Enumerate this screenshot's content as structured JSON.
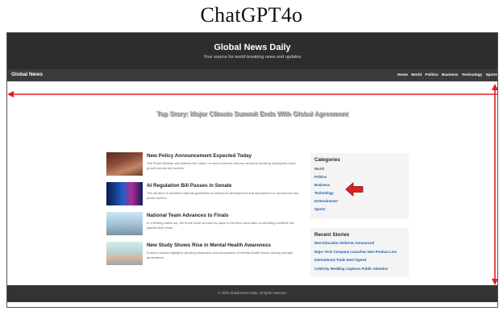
{
  "caption": "ChatGPT4o",
  "site": {
    "title": "Global News Daily",
    "tagline": "Your source for world-breaking news and updates"
  },
  "navbar": {
    "brand": "Global News",
    "links": [
      "Home",
      "World",
      "Politics",
      "Business",
      "Technology",
      "Sports"
    ]
  },
  "top_story": "Top Story: Major Climate Summit Ends With Global Agreement",
  "articles": [
    {
      "title": "New Policy Announcement Expected Today",
      "summary": "The Prime Minister will address the nation on new economic reforms aimed at boosting employment and growth across key sectors."
    },
    {
      "title": "AI Regulation Bill Passes in Senate",
      "summary": "The bill aims to establish national guidelines for ethical AI development and deployment in commercial and public sectors."
    },
    {
      "title": "National Team Advances to Finals",
      "summary": "In a thrilling match-up, the home team secures its place in the final round after a nail-biting overtime win against their rivals."
    },
    {
      "title": "New Study Shows Rise in Mental Health Awareness",
      "summary": "A recent survey highlights growing awareness and acceptance of mental health issues among younger generations."
    }
  ],
  "categories": {
    "heading": "Categories",
    "items": [
      "World",
      "Politics",
      "Business",
      "Technology",
      "Entertainment",
      "Sports"
    ]
  },
  "recent_stories": {
    "heading": "Recent Stories",
    "items": [
      "New Education Reforms Announced",
      "Major Tech Company Launches New Product Line",
      "International Trade Deal Signed",
      "Celebrity Wedding Captures Public Attention"
    ]
  },
  "footer": "© 2025 Global News Daily. All rights reserved.",
  "colors": {
    "header_bg": "#2d2d2d",
    "nav_bg": "#3b3b3b",
    "link": "#1a5fb4",
    "annotation": "#e02020"
  }
}
